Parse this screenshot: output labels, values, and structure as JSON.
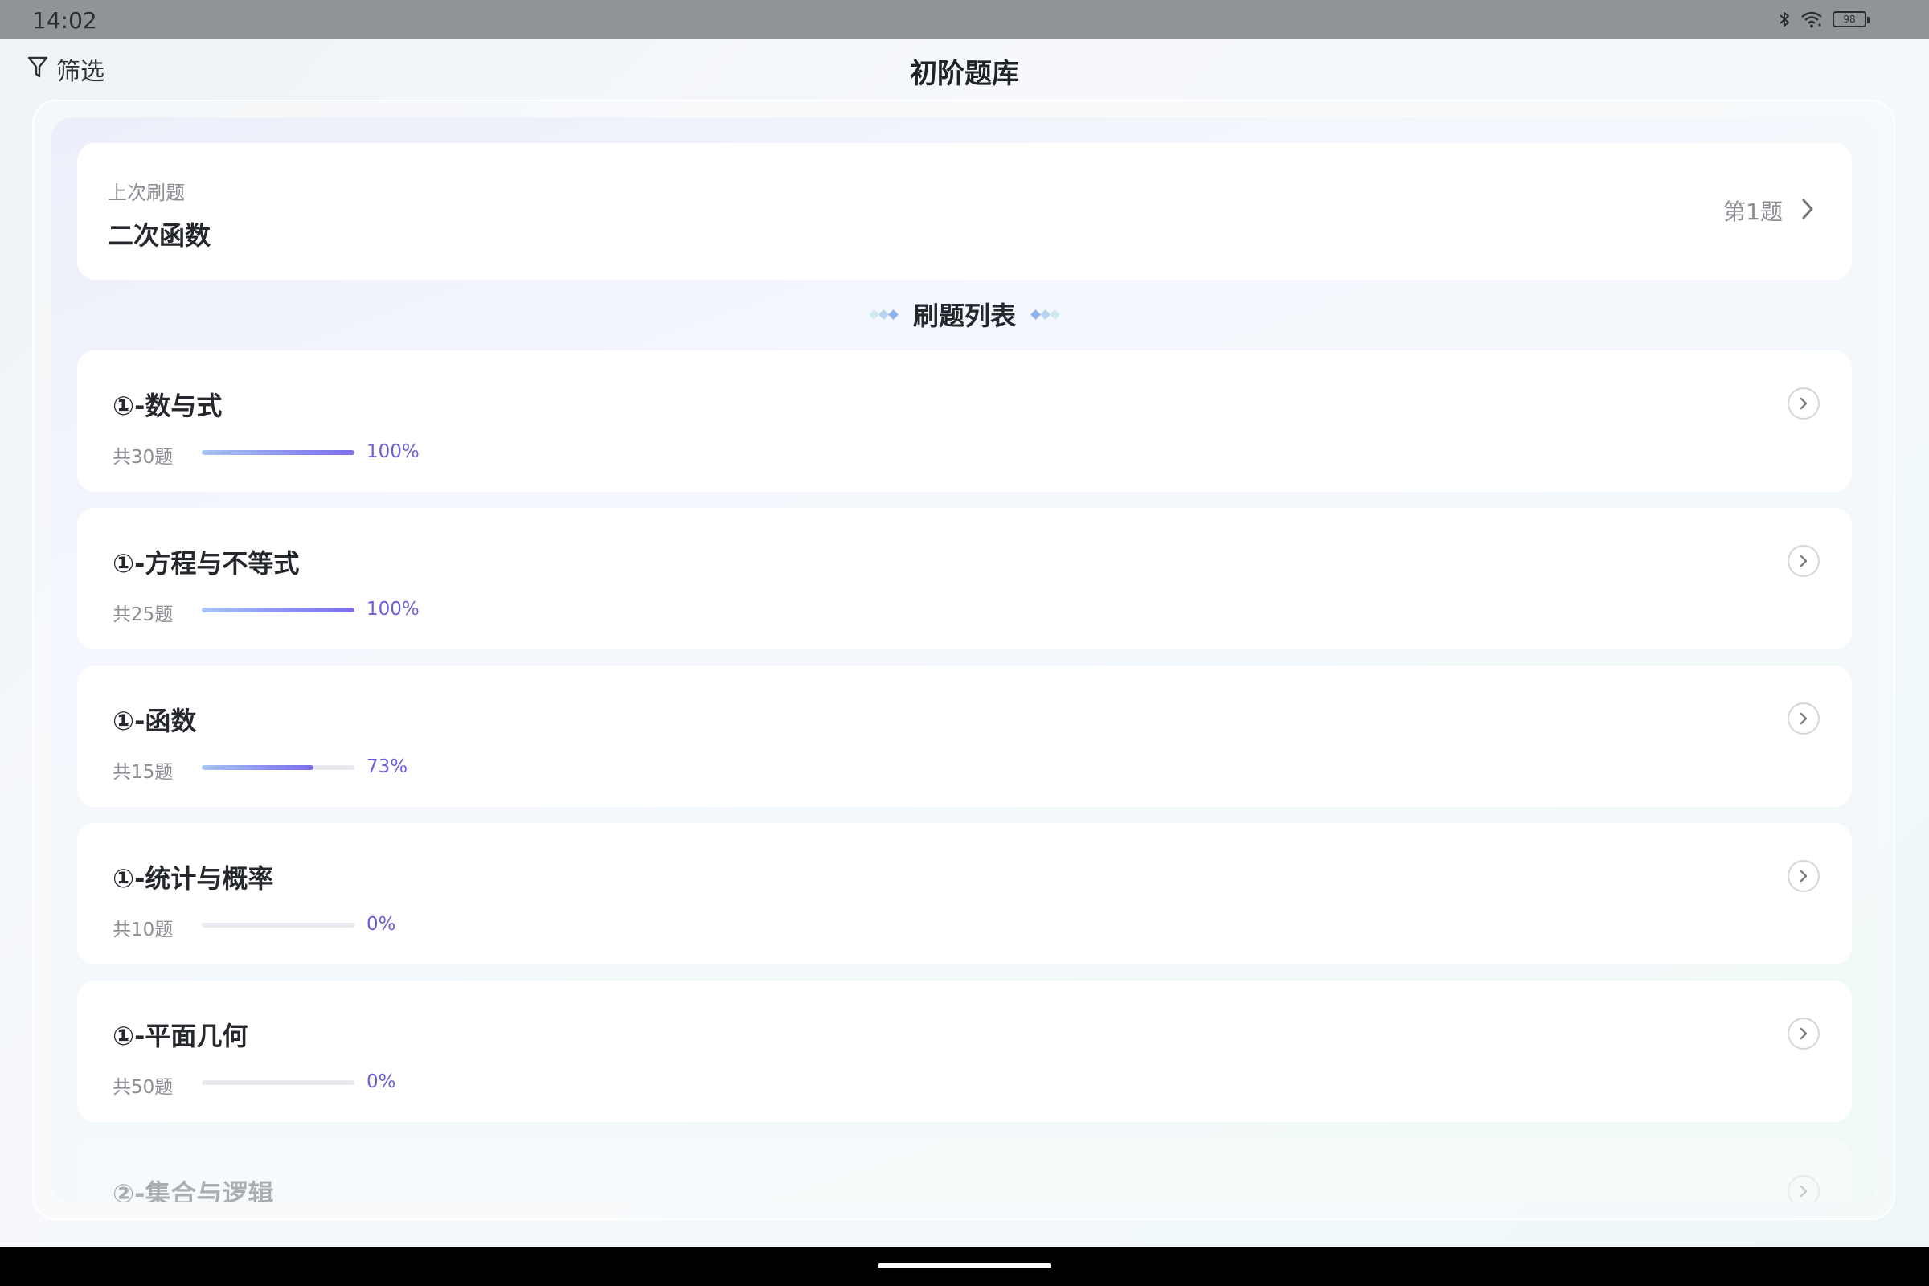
{
  "status_bar": {
    "time": "14:02",
    "battery": "98",
    "icons": [
      "bluetooth-icon",
      "wifi-icon",
      "battery-icon"
    ]
  },
  "header": {
    "filter_label": "筛选",
    "title": "初阶题库"
  },
  "last_practice": {
    "label": "上次刷题",
    "topic": "二次函数",
    "progress": "第1题"
  },
  "section": {
    "title": "刷题列表"
  },
  "topics": [
    {
      "title": "①-数与式",
      "count": "共30题",
      "percent": "100%",
      "progress": 1.0
    },
    {
      "title": "①-方程与不等式",
      "count": "共25题",
      "percent": "100%",
      "progress": 1.0
    },
    {
      "title": "①-函数",
      "count": "共15题",
      "percent": "73%",
      "progress": 0.73
    },
    {
      "title": "①-统计与概率",
      "count": "共10题",
      "percent": "0%",
      "progress": 0
    },
    {
      "title": "①-平面几何",
      "count": "共50题",
      "percent": "0%",
      "progress": 0
    },
    {
      "title": "②-集合与逻辑",
      "count": "",
      "percent": "",
      "progress": null
    }
  ],
  "colors": {
    "accent": "#7d6ee8",
    "progress_start": "#a7c6f3",
    "percent_text": "#6a5fd6",
    "status_bar": "#8f9498"
  }
}
